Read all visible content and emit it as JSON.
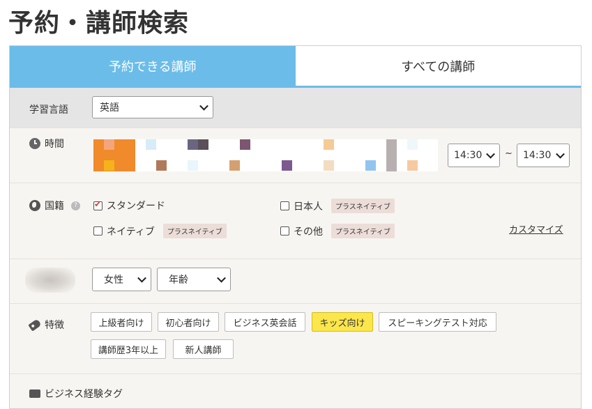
{
  "page": {
    "title": "予約・講師検索"
  },
  "tabs": [
    {
      "label": "予約できる講師",
      "active": true
    },
    {
      "label": "すべての講師",
      "active": false
    }
  ],
  "language": {
    "label": "学習言語",
    "value": "英語"
  },
  "time": {
    "label": "時間",
    "from": "14:30",
    "to": "14:30",
    "separator": "~"
  },
  "nationality": {
    "label": "国籍",
    "help": "?",
    "options": [
      {
        "label": "スタンダード",
        "checked": true,
        "tag": ""
      },
      {
        "label": "日本人",
        "checked": false,
        "tag": "プラスネイティブ"
      },
      {
        "label": "ネイティブ",
        "checked": false,
        "tag": "プラスネイティブ"
      },
      {
        "label": "その他",
        "checked": false,
        "tag": "プラスネイティブ"
      }
    ],
    "customize": "カスタマイズ"
  },
  "gender": {
    "value": "女性",
    "age": "年齢"
  },
  "features": {
    "label": "特徴",
    "chips": [
      {
        "label": "上級者向け",
        "selected": false
      },
      {
        "label": "初心者向け",
        "selected": false
      },
      {
        "label": "ビジネス英会話",
        "selected": false
      },
      {
        "label": "キッズ向け",
        "selected": true
      },
      {
        "label": "スピーキングテスト対応",
        "selected": false
      },
      {
        "label": "講師歴3年以上",
        "selected": false
      },
      {
        "label": "新人講師",
        "selected": false
      }
    ]
  },
  "experience": {
    "label": "ビジネス経験タグ"
  },
  "colors": {
    "tab_active": "#6bbce9",
    "chip_selected": "#fbe64b",
    "tag_bg": "#ecddd8"
  }
}
